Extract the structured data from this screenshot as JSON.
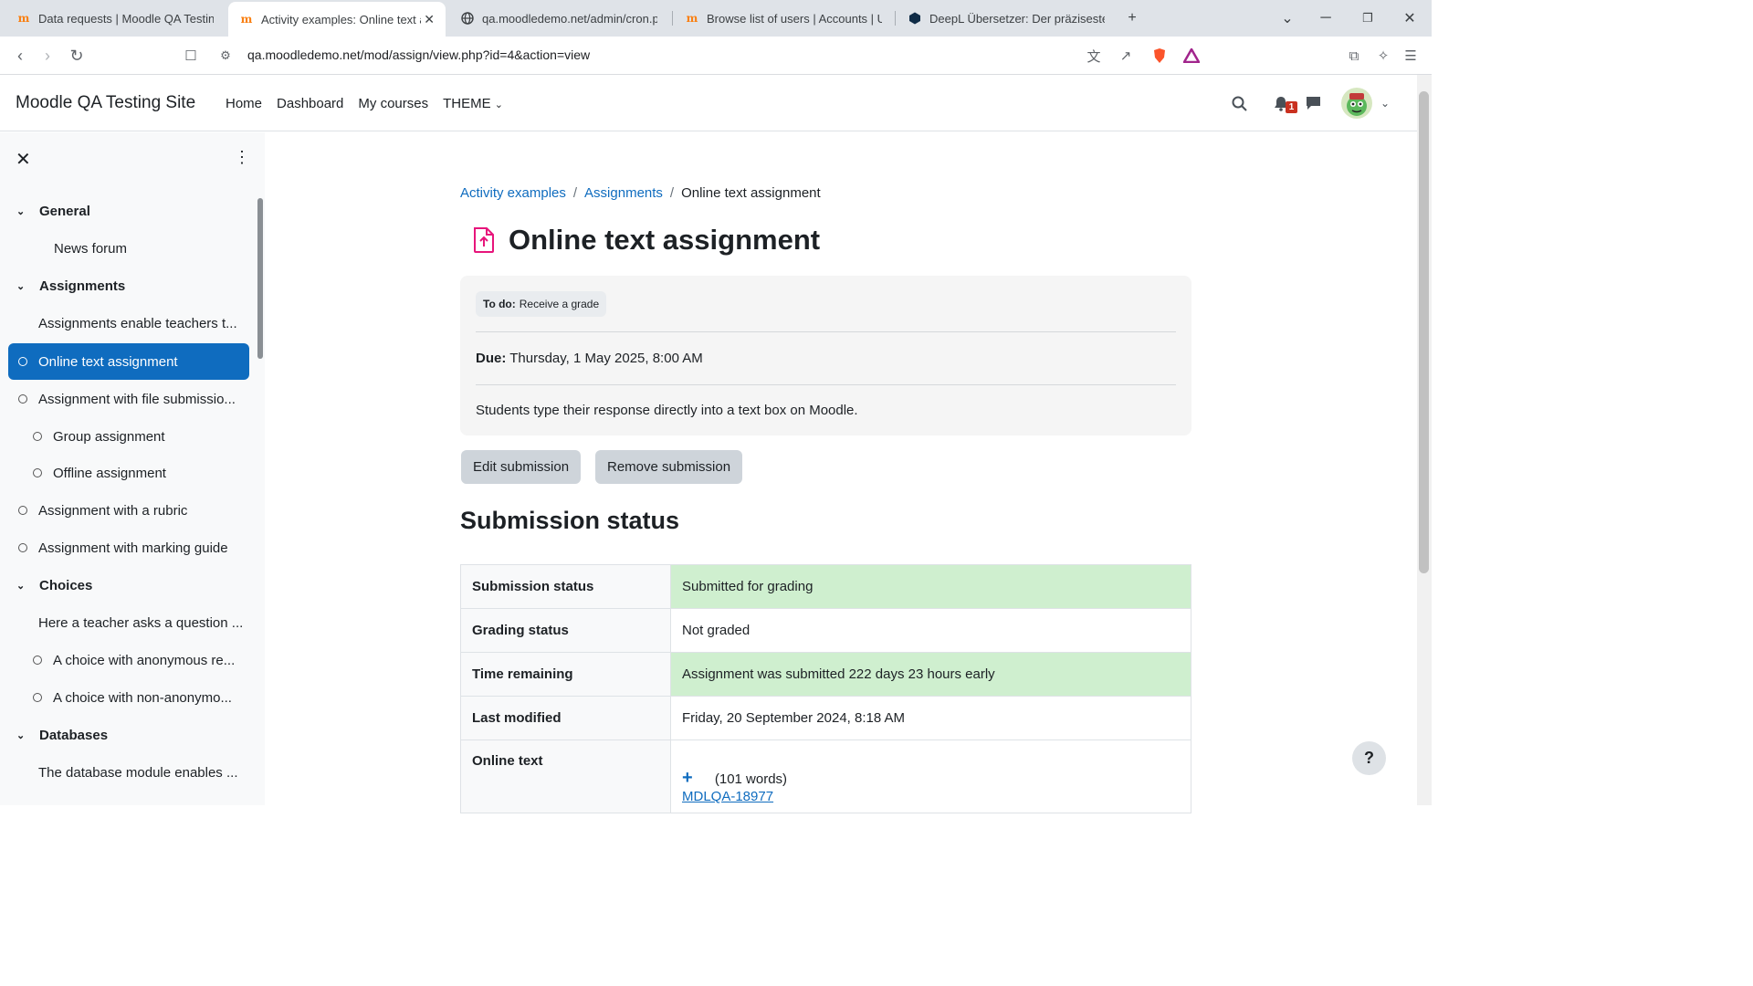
{
  "browser": {
    "tabs": [
      {
        "title": "Data requests | Moodle QA Testing",
        "favicon": "moodle-icon"
      },
      {
        "title": "Activity examples: Online text a",
        "favicon": "moodle-icon",
        "active": true
      },
      {
        "title": "qa.moodledemo.net/admin/cron.ph",
        "favicon": "globe-icon"
      },
      {
        "title": "Browse list of users | Accounts | Use",
        "favicon": "moodle-icon"
      },
      {
        "title": "DeepL Übersetzer: Der präziseste Ü",
        "favicon": "deepl-icon"
      }
    ],
    "url": "qa.moodledemo.net/mod/assign/view.php?id=4&action=view"
  },
  "navbar": {
    "site_name": "Moodle QA Testing Site",
    "items": [
      "Home",
      "Dashboard",
      "My courses",
      "THEME"
    ],
    "notification_count": "1"
  },
  "course_index": {
    "items": [
      {
        "label": "General",
        "type": "section"
      },
      {
        "label": "News forum",
        "type": "activity-plain"
      },
      {
        "label": "Assignments",
        "type": "section"
      },
      {
        "label": "Assignments enable teachers t...",
        "type": "label"
      },
      {
        "label": "Online text assignment",
        "type": "activity",
        "active": true
      },
      {
        "label": "Assignment with file submissio...",
        "type": "activity"
      },
      {
        "label": "Group assignment",
        "type": "activity-indent"
      },
      {
        "label": "Offline assignment",
        "type": "activity-indent"
      },
      {
        "label": "Assignment with a rubric",
        "type": "activity"
      },
      {
        "label": "Assignment with marking guide",
        "type": "activity"
      },
      {
        "label": "Choices",
        "type": "section"
      },
      {
        "label": "Here a teacher asks a question ...",
        "type": "label"
      },
      {
        "label": "A choice with anonymous re...",
        "type": "activity-indent"
      },
      {
        "label": "A choice with non-anonymo...",
        "type": "activity-indent"
      },
      {
        "label": "Databases",
        "type": "section"
      },
      {
        "label": "The database module enables ...",
        "type": "label"
      }
    ]
  },
  "breadcrumb": {
    "items": [
      "Activity examples",
      "Assignments",
      "Online text assignment"
    ]
  },
  "page": {
    "title": "Online text assignment",
    "todo_label": "To do:",
    "todo_value": "Receive a grade",
    "due_label": "Due:",
    "due_value": "Thursday, 1 May 2025, 8:00 AM",
    "description": "Students type their response directly into a text box on Moodle.",
    "edit_button": "Edit submission",
    "remove_button": "Remove submission",
    "section_heading": "Submission status"
  },
  "submission_table": {
    "rows": [
      {
        "label": "Submission status",
        "value": "Submitted for grading"
      },
      {
        "label": "Grading status",
        "value": "Not graded"
      },
      {
        "label": "Time remaining",
        "value": "Assignment was submitted 222 days 23 hours early"
      },
      {
        "label": "Last modified",
        "value": "Friday, 20 September 2024, 8:18 AM"
      },
      {
        "label": "Online text",
        "plus": "+",
        "words": "(101 words)",
        "link": "MDLQA-18977"
      }
    ]
  },
  "help_button": "?"
}
